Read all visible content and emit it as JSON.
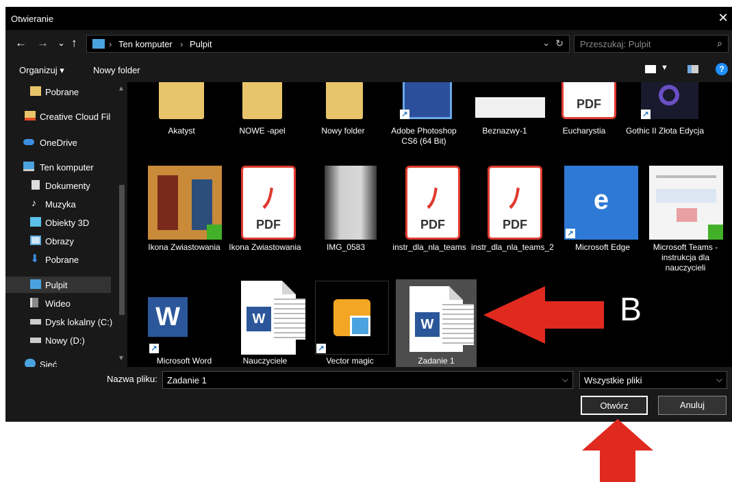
{
  "dialog": {
    "title": "Otwieranie",
    "close_symbol": "✕"
  },
  "nav": {
    "back": "←",
    "forward": "→",
    "recent": "⌄",
    "up": "↑",
    "breadcrumb": [
      "Ten komputer",
      "Pulpit"
    ],
    "separator": "›",
    "search_placeholder": "Przeszukaj: Pulpit"
  },
  "toolbar": {
    "organize": "Organizuj ▾",
    "new_folder": "Nowy folder",
    "help": "?"
  },
  "sidebar": {
    "items": [
      {
        "label": "Pobrane",
        "icon": "folder-icon"
      },
      {
        "label": "Creative Cloud Fil",
        "icon": "creative-cloud-icon"
      },
      {
        "label": "OneDrive",
        "icon": "cloud-icon"
      },
      {
        "label": "Ten komputer",
        "icon": "computer-icon"
      },
      {
        "label": "Dokumenty",
        "icon": "documents-icon"
      },
      {
        "label": "Muzyka",
        "icon": "music-icon"
      },
      {
        "label": "Obiekty 3D",
        "icon": "3d-objects-icon"
      },
      {
        "label": "Obrazy",
        "icon": "pictures-icon"
      },
      {
        "label": "Pobrane",
        "icon": "download-icon"
      },
      {
        "label": "Pulpit",
        "icon": "desktop-icon"
      },
      {
        "label": "Wideo",
        "icon": "video-icon"
      },
      {
        "label": "Dysk lokalny (C:)",
        "icon": "drive-icon"
      },
      {
        "label": "Nowy (D:)",
        "icon": "drive-icon"
      },
      {
        "label": "Sieć",
        "icon": "network-icon"
      }
    ],
    "selected": "Pulpit"
  },
  "files": {
    "row1": [
      {
        "label": "Akatyst",
        "icon": "folder-icon"
      },
      {
        "label": "NOWE -apel",
        "icon": "folder-icon"
      },
      {
        "label": "Nowy folder",
        "icon": "folder-icon"
      },
      {
        "label": "Adobe Photoshop CS6 (64 Bit)",
        "icon": "photoshop-icon"
      },
      {
        "label": "Beznazwy-1",
        "icon": "image-thumbnail"
      },
      {
        "label": "Eucharystia",
        "icon": "pdf-icon"
      },
      {
        "label": "Gothic II Złota Edycja",
        "icon": "game-icon"
      }
    ],
    "row2": [
      {
        "label": "Ikona Zwiastowania",
        "icon": "image-thumbnail"
      },
      {
        "label": "Ikona Zwiastowania",
        "icon": "pdf-icon"
      },
      {
        "label": "IMG_0583",
        "icon": "image-thumbnail"
      },
      {
        "label": "instr_dla_nla_teams",
        "icon": "pdf-icon"
      },
      {
        "label": "instr_dla_nla_teams_2",
        "icon": "pdf-icon"
      },
      {
        "label": "Microsoft Edge",
        "icon": "edge-icon"
      },
      {
        "label": "Microsoft Teams - instrukcja dla nauczycieli",
        "icon": "image-thumbnail"
      }
    ],
    "row3": [
      {
        "label": "Microsoft Word",
        "icon": "word-icon"
      },
      {
        "label": "Nauczyciele",
        "icon": "word-file-icon"
      },
      {
        "label": "Vector magic",
        "icon": "vector-magic-icon"
      },
      {
        "label": "Zadanie 1",
        "icon": "word-file-icon"
      }
    ],
    "pdf_text": "PDF",
    "word_letter": "W",
    "edge_letter": "e",
    "shortcut_glyph": "↗"
  },
  "bottom": {
    "filename_label": "Nazwa pliku:",
    "filename_value": "Zadanie 1",
    "filetype_value": "Wszystkie pliki",
    "open_button": "Otwórz",
    "cancel_button": "Anuluj",
    "dropdown_symbol": "⌵"
  },
  "annotation": {
    "letter": "B",
    "arrow_color": "#e02a1f"
  }
}
